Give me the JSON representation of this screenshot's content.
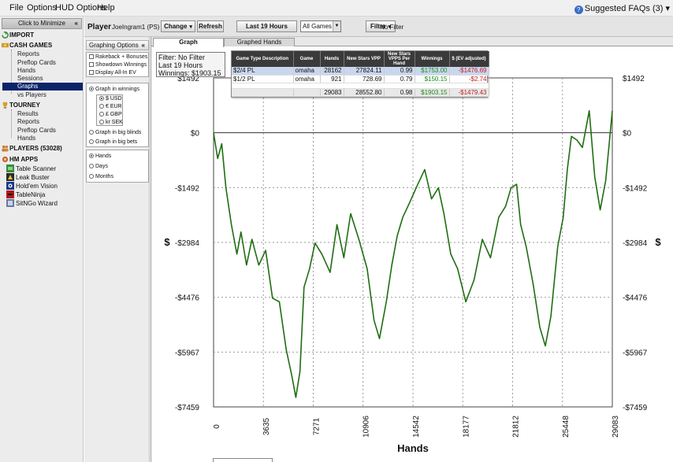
{
  "menubar": {
    "items": [
      "File",
      "Options",
      "HUD Options",
      "Help"
    ],
    "faqs": "Suggested FAQs (3)"
  },
  "sidebar": {
    "minimize": "Click to Minimize",
    "import": "IMPORT",
    "cash": {
      "title": "CASH GAMES",
      "items": [
        "Reports",
        "Preflop Cards",
        "Hands",
        "Sessions",
        "Graphs",
        "vs Players"
      ]
    },
    "tourney": {
      "title": "TOURNEY",
      "items": [
        "Results",
        "Reports",
        "Preflop Cards",
        "Hands"
      ]
    },
    "players": "PLAYERS (53028)",
    "hmapps": {
      "title": "HM APPS",
      "items": [
        "Table Scanner",
        "Leak Buster",
        "Hold'em Vision",
        "TableNinja",
        "SitNGo Wizard"
      ]
    }
  },
  "playerbar": {
    "player_label": "Player",
    "player_name": "JoeIngram1 (PS)",
    "change": "Change",
    "refresh": "Refresh",
    "last": "Last  19 Hours",
    "games": "All Games",
    "filter": "Filter",
    "nofilter": "No Filter"
  },
  "options": {
    "header": "Graphing Options",
    "checks": [
      "Rakeback + Bonuses",
      "Showdown Winnings",
      "Display All-In EV"
    ],
    "graph_in_winnings": "Graph in winnings",
    "currencies": [
      "$ USD",
      "€ EUR",
      "£ GBP",
      "kr SEK"
    ],
    "big_blinds": "Graph in big blinds",
    "big_bets": "Graph in big bets",
    "xaxis": [
      "Hands",
      "Days",
      "Months"
    ]
  },
  "tabs": [
    "Graph",
    "Graphed Hands"
  ],
  "filterbox": {
    "line1": "Filter: No Filter",
    "line2": "Last  19 Hours",
    "line3": "Winnings: $1903.15"
  },
  "summary": {
    "headers": [
      "Game Type Description",
      "Game",
      "Hands",
      "New Stars VPP",
      "New Stars VPPS Per Hand",
      "Winnings",
      "$ (EV adjusted)"
    ],
    "rows": [
      [
        "$2/4 PL",
        "omaha",
        "28162",
        "27824.11",
        "0.99",
        "$1753.00",
        "-$1476.69"
      ],
      [
        "$1/2 PL",
        "omaha",
        "921",
        "728.69",
        "0.79",
        "$150.15",
        "-$2.74"
      ]
    ],
    "total": [
      "",
      "",
      "29083",
      "28552.80",
      "0.98",
      "$1903.15",
      "-$1479.43"
    ]
  },
  "colors": {
    "line": "#1f6e12",
    "positive": "#1a8a1a",
    "negative": "#c02020",
    "selection": "#0a246a"
  },
  "chart_data": {
    "type": "line",
    "xlabel": "Hands",
    "ylabel": "$",
    "xlim": [
      0,
      29083
    ],
    "ylim": [
      -7459,
      1492
    ],
    "x_ticks": [
      "0",
      "3635",
      "7271",
      "10906",
      "14542",
      "18177",
      "21812",
      "25448",
      "29083"
    ],
    "y_ticks": [
      "$1492",
      "$0",
      "-$1492",
      "-$2984",
      "-$4476",
      "-$5967",
      "-$7459"
    ],
    "grid": true,
    "series": [
      {
        "name": "",
        "x": [
          0,
          300,
          600,
          900,
          1300,
          1700,
          2000,
          2400,
          2800,
          3300,
          3800,
          4300,
          4800,
          5300,
          5700,
          6000,
          6300,
          6600,
          7000,
          7400,
          7900,
          8500,
          9000,
          9500,
          10000,
          10600,
          11200,
          11700,
          12100,
          12600,
          13000,
          13400,
          13800,
          14300,
          14900,
          15400,
          15900,
          16400,
          16800,
          17300,
          17800,
          18400,
          19000,
          19600,
          20200,
          20800,
          21300,
          21700,
          22100,
          22400,
          22800,
          23300,
          23800,
          24200,
          24600,
          25100,
          25500,
          25800,
          26100,
          26500,
          26900,
          27400,
          27800,
          28200,
          28600,
          29083
        ],
        "y": [
          0,
          -700,
          -300,
          -1500,
          -2500,
          -3300,
          -2700,
          -3600,
          -2900,
          -3600,
          -3200,
          -4500,
          -4600,
          -5900,
          -6600,
          -7200,
          -6500,
          -4200,
          -3700,
          -3000,
          -3300,
          -3800,
          -2500,
          -3400,
          -2200,
          -2900,
          -3700,
          -5100,
          -5600,
          -4600,
          -3600,
          -2800,
          -2300,
          -1900,
          -1400,
          -1000,
          -1800,
          -1500,
          -2200,
          -3300,
          -3700,
          -4600,
          -4000,
          -2900,
          -3400,
          -2300,
          -2000,
          -1500,
          -1400,
          -2500,
          -3100,
          -4100,
          -5300,
          -5800,
          -5000,
          -3100,
          -2300,
          -1000,
          -100,
          -200,
          -400,
          600,
          -1200,
          -2100,
          -1300,
          600
        ]
      }
    ]
  }
}
